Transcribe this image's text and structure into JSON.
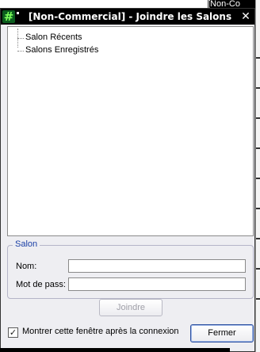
{
  "background": {
    "top_right_text": "[Non-Co"
  },
  "window": {
    "title": "[Non-Commercial] - Joindre les Salons",
    "app_icon_glyph": "#",
    "close_glyph": "✕"
  },
  "tree": {
    "items": [
      {
        "label": "Salon Récents"
      },
      {
        "label": "Salons Enregistrés"
      }
    ]
  },
  "salon_group": {
    "legend": "Salon",
    "name_label": "Nom:",
    "name_value": "",
    "password_label": "Mot de pass:",
    "password_value": ""
  },
  "buttons": {
    "join": "Joindre",
    "close": "Fermer"
  },
  "options": {
    "show_after_connect_label": "Montrer cette fenêtre après la connexion",
    "show_after_connect_checked": true,
    "check_glyph": "✓"
  },
  "colors": {
    "titlebar": "#000000",
    "dialog_bg": "#eeeef2",
    "legend_text": "#1a3fa6"
  }
}
